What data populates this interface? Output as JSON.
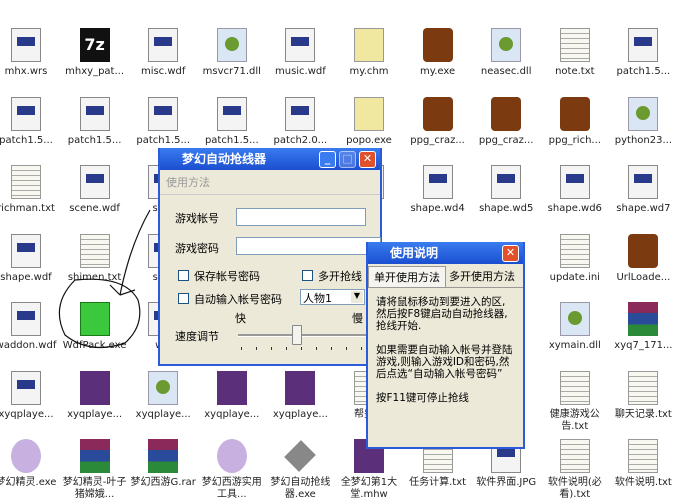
{
  "desktop": {
    "rows": [
      [
        {
          "l": "mhx.wrs",
          "t": "doc"
        },
        {
          "l": "mhxy_pat...",
          "t": "sevz"
        },
        {
          "l": "misc.wdf",
          "t": "doc"
        },
        {
          "l": "msvcr71.dll",
          "t": "dll"
        },
        {
          "l": "music.wdf",
          "t": "doc"
        },
        {
          "l": "my.chm",
          "t": "chm"
        },
        {
          "l": "my.exe",
          "t": "game"
        },
        {
          "l": "neasec.dll",
          "t": "dll"
        },
        {
          "l": "note.txt",
          "t": "txt"
        },
        {
          "l": "patch1.5...",
          "t": "doc"
        }
      ],
      [
        {
          "l": "patch1.5...",
          "t": "doc"
        },
        {
          "l": "patch1.5...",
          "t": "doc"
        },
        {
          "l": "patch1.5...",
          "t": "doc"
        },
        {
          "l": "patch1.5...",
          "t": "doc"
        },
        {
          "l": "patch2.0...",
          "t": "doc"
        },
        {
          "l": "popo.exe",
          "t": "chm"
        },
        {
          "l": "ppg_craz...",
          "t": "game"
        },
        {
          "l": "ppg_craz...",
          "t": "game"
        },
        {
          "l": "ppg_rich...",
          "t": "game"
        },
        {
          "l": "python23...",
          "t": "dll"
        }
      ],
      [
        {
          "l": "richman.txt",
          "t": "txt"
        },
        {
          "l": "scene.wdf",
          "t": "doc"
        },
        {
          "l": "serv",
          "t": "doc"
        },
        null,
        null,
        {
          "l": "vd3",
          "t": "doc"
        },
        {
          "l": "shape.wd4",
          "t": "doc"
        },
        {
          "l": "shape.wd5",
          "t": "doc"
        },
        {
          "l": "shape.wd6",
          "t": "doc"
        },
        {
          "l": "shape.wd7",
          "t": "doc"
        }
      ],
      [
        {
          "l": "shape.wdf",
          "t": "doc"
        },
        {
          "l": "shimen.txt",
          "t": "txt"
        },
        {
          "l": "sme",
          "t": "doc"
        },
        null,
        null,
        null,
        null,
        null,
        {
          "l": "update.ini",
          "t": "txt"
        },
        {
          "l": "UrlLoade...",
          "t": "game"
        }
      ],
      [
        {
          "l": "waddon.wdf",
          "t": "doc"
        },
        {
          "l": "WdfPack.exe",
          "t": "box"
        },
        {
          "l": "wzi",
          "t": "doc"
        },
        null,
        null,
        null,
        null,
        null,
        {
          "l": "xymain.dll",
          "t": "dll"
        },
        {
          "l": "xyq7_171...",
          "t": "rar"
        }
      ],
      [
        {
          "l": "xyqplaye...",
          "t": "doc"
        },
        {
          "l": "xyqplaye...",
          "t": "mon"
        },
        {
          "l": "xyqplaye...",
          "t": "dll"
        },
        {
          "l": "xyqplaye...",
          "t": "mon"
        },
        {
          "l": "xyqplaye...",
          "t": "mon"
        },
        {
          "l": "帮费录",
          "t": "txt"
        },
        null,
        null,
        {
          "l": "健康游戏公告.txt",
          "t": "txt"
        },
        {
          "l": "聊天记录.txt",
          "t": "txt"
        }
      ],
      [
        {
          "l": "梦幻精灵.exe",
          "t": "girl"
        },
        {
          "l": "梦幻精灵-叶子猪嫦娥...",
          "t": "rar"
        },
        {
          "l": "梦幻西游G.rar",
          "t": "rar"
        },
        {
          "l": "梦幻西游实用工具...",
          "t": "girl"
        },
        {
          "l": "梦幻自动抢线器.exe",
          "t": "tool"
        },
        {
          "l": "全梦幻第1大堂.mhw",
          "t": "mon"
        },
        {
          "l": "任务计算.txt",
          "t": "txt"
        },
        {
          "l": "软件界面.JPG",
          "t": "doc"
        },
        {
          "l": "软件说明(必看).txt",
          "t": "txt"
        },
        {
          "l": "软件说明.txt",
          "t": "txt"
        }
      ]
    ]
  },
  "main_window": {
    "title": "梦幻自动抢线器",
    "menu": "使用方法",
    "account_label": "游戏帐号",
    "password_label": "游戏密码",
    "account_value": "",
    "password_value": "",
    "save_checkbox": "保存帐号密码",
    "multi_checkbox": "多开抢线",
    "auto_checkbox": "自动输入帐号密码",
    "character_select": "人物1",
    "fast": "快",
    "slow": "慢",
    "speed_label": "速度调节",
    "speed_level": 0.4
  },
  "help_window": {
    "title": "使用说明",
    "tabs": [
      "单开使用方法",
      "多开使用方法"
    ],
    "active_tab": 0,
    "paragraphs": [
      "请将鼠标移动到要进入的区,然后按F8键启动自动抢线器,抢线开始.",
      "如果需要自动输入帐号并登陆游戏,则输入游戏ID和密码,然后点选“自动输入帐号密码”",
      "按F11键可停止抢线"
    ]
  },
  "colors": {
    "titlebar": "#2b5bd8",
    "window_bg": "#ece9d8",
    "close": "#e0502a"
  }
}
